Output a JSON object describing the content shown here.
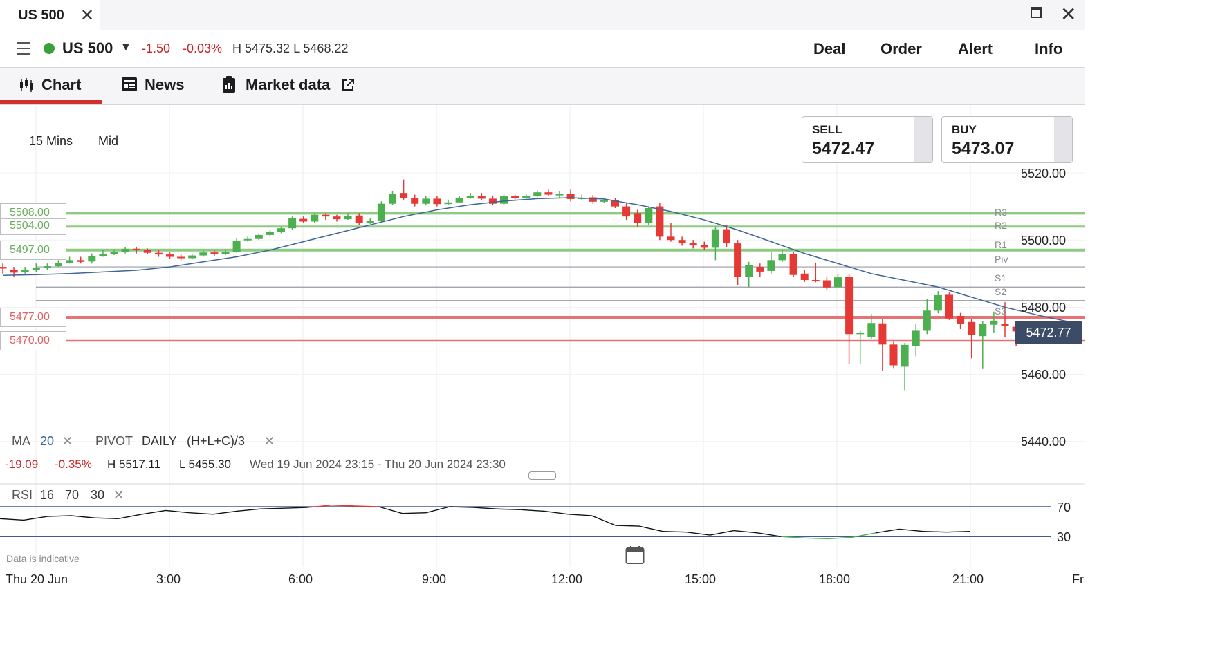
{
  "window": {
    "tab_title": "US 500"
  },
  "header": {
    "instrument": "US 500",
    "change_points": "-1.50",
    "change_percent": "-0.03%",
    "high_low": "H 5475.32  L 5468.22",
    "actions": [
      "Deal",
      "Order",
      "Alert",
      "Info"
    ]
  },
  "tabs": [
    {
      "label": "Chart",
      "icon": "candlestick-icon",
      "active": true
    },
    {
      "label": "News",
      "icon": "newspaper-icon"
    },
    {
      "label": "Market data",
      "icon": "clipboard-icon",
      "external": "external-link-icon"
    }
  ],
  "chart_controls": {
    "timeframe": "15 Mins",
    "price_type": "Mid"
  },
  "quotes": {
    "sell_label": "SELL",
    "sell_value": "5472.47",
    "buy_label": "BUY",
    "buy_value": "5473.07"
  },
  "current_price": "5472.77",
  "level_boxes": {
    "r3": "5508.00",
    "r2": "5504.00",
    "r1": "5497.00",
    "s3": "5477.00",
    "s4": "5470.00"
  },
  "pivot_labels": {
    "r3": "R3",
    "r2": "R2",
    "r1": "R1",
    "piv": "Piv",
    "s1": "S1",
    "s2": "S2",
    "s3": "S3"
  },
  "indicators": {
    "ma_label": "MA",
    "ma_period": "20",
    "pivot_label": "PIVOT",
    "pivot_period": "DAILY",
    "pivot_formula": "(H+L+C)/3",
    "rsi_label": "RSI",
    "rsi_period": "16",
    "rsi_upper": "70",
    "rsi_lower": "30"
  },
  "period_stats": {
    "change": "-19.09",
    "change_pct": "-0.35%",
    "high": "H 5517.11",
    "low": "L 5455.30",
    "range": "Wed 19 Jun 2024 23:15 - Thu 20 Jun 2024 23:30"
  },
  "disclaimer": "Data is indicative",
  "colors": {
    "up": "#4caf50",
    "down": "#e53935",
    "ma": "#3d6596",
    "resistance": "#8fca83",
    "support": "#e57373",
    "accent": "#d32f2f"
  },
  "chart_data": {
    "type": "candlestick",
    "y_ticks": [
      "5520.00",
      "5500.00",
      "5480.00",
      "5460.00",
      "5440.00"
    ],
    "ylim": [
      5435,
      5540
    ],
    "x_ticks": [
      "Thu 20 Jun",
      "3:00",
      "6:00",
      "9:00",
      "12:00",
      "15:00",
      "18:00",
      "21:00",
      "Fr"
    ],
    "levels": {
      "R3": 5508,
      "R2": 5504,
      "R1": 5497,
      "Piv": 5492,
      "S1": 5486,
      "S2": 5482,
      "S3": 5477,
      "S4": 5470
    },
    "candles": [
      [
        5492,
        5491.5,
        5493,
        5490
      ],
      [
        5491,
        5490.3,
        5492,
        5489
      ],
      [
        5490.4,
        5491.2,
        5492,
        5490
      ],
      [
        5491,
        5491.8,
        5493,
        5490.5
      ],
      [
        5491.8,
        5492.2,
        5493,
        5491
      ],
      [
        5492.2,
        5493.2,
        5494,
        5492
      ],
      [
        5493.2,
        5494,
        5495,
        5493
      ],
      [
        5494,
        5493.5,
        5495,
        5493
      ],
      [
        5493.6,
        5495.2,
        5496,
        5493
      ],
      [
        5495.2,
        5495.8,
        5497,
        5495
      ],
      [
        5495.8,
        5496.4,
        5497,
        5495.5
      ],
      [
        5496.4,
        5497.4,
        5498,
        5496
      ],
      [
        5497.4,
        5497,
        5498,
        5496
      ],
      [
        5497,
        5496.2,
        5497.5,
        5495.8
      ],
      [
        5496.2,
        5495.7,
        5497,
        5495
      ],
      [
        5495.7,
        5495,
        5496.3,
        5494.5
      ],
      [
        5495,
        5494.6,
        5495.8,
        5494
      ],
      [
        5494.6,
        5495.4,
        5496,
        5494.2
      ],
      [
        5495.4,
        5496.3,
        5497,
        5495
      ],
      [
        5496.3,
        5495.9,
        5497,
        5495.3
      ],
      [
        5495.9,
        5496.5,
        5497.3,
        5495.5
      ],
      [
        5496.5,
        5499.8,
        5500.5,
        5496.2
      ],
      [
        5500,
        5500.3,
        5501,
        5499.5
      ],
      [
        5500.3,
        5501.5,
        5502,
        5500
      ],
      [
        5501.5,
        5502.5,
        5503,
        5501
      ],
      [
        5502.5,
        5503.5,
        5504,
        5502
      ],
      [
        5503.5,
        5506.5,
        5507,
        5503
      ],
      [
        5506.3,
        5505.5,
        5507,
        5505
      ],
      [
        5505.5,
        5507.5,
        5508,
        5505.2
      ],
      [
        5507.5,
        5507,
        5508,
        5506
      ],
      [
        5507,
        5506.2,
        5507.5,
        5505.5
      ],
      [
        5506.2,
        5507.2,
        5508,
        5506
      ],
      [
        5507.3,
        5505,
        5508,
        5504.5
      ],
      [
        5505,
        5505.7,
        5506.5,
        5504.8
      ],
      [
        5505.7,
        5510.8,
        5511.5,
        5505.5
      ],
      [
        5510.8,
        5513.8,
        5514.5,
        5510.5
      ],
      [
        5514,
        5512.5,
        5518,
        5512
      ],
      [
        5512.5,
        5510.8,
        5513.5,
        5510
      ],
      [
        5510.8,
        5512.3,
        5513,
        5510.5
      ],
      [
        5512.3,
        5510.7,
        5513,
        5510
      ],
      [
        5510.7,
        5511.2,
        5512,
        5510.3
      ],
      [
        5511.2,
        5512.6,
        5513.2,
        5511
      ],
      [
        5512.6,
        5513.2,
        5514,
        5512.3
      ],
      [
        5513,
        5512.3,
        5514,
        5512
      ],
      [
        5512.3,
        5510.8,
        5513,
        5510.3
      ],
      [
        5510.8,
        5513,
        5513.5,
        5510.5
      ],
      [
        5513,
        5512.5,
        5513.5,
        5512
      ],
      [
        5512.6,
        5513.2,
        5513.8,
        5512.3
      ],
      [
        5513.2,
        5514.2,
        5514.8,
        5512.8
      ],
      [
        5514.2,
        5513.5,
        5515,
        5513
      ],
      [
        5513.5,
        5513.7,
        5514.6,
        5512.5
      ],
      [
        5513.7,
        5512.2,
        5515,
        5511.5
      ],
      [
        5512.3,
        5512.6,
        5513.5,
        5511.8
      ],
      [
        5512.7,
        5511.4,
        5513.4,
        5510.8
      ],
      [
        5511.4,
        5511.8,
        5512.4,
        5511
      ],
      [
        5511.8,
        5510,
        5512.5,
        5509.5
      ],
      [
        5510,
        5507,
        5511,
        5506
      ],
      [
        5508,
        5505,
        5509,
        5504
      ],
      [
        5505,
        5509.5,
        5510,
        5504.5
      ],
      [
        5510,
        5501,
        5511,
        5500
      ],
      [
        5501,
        5500,
        5505,
        5499.5
      ],
      [
        5500,
        5499.2,
        5501,
        5498.3
      ],
      [
        5499.2,
        5498.5,
        5500,
        5497.5
      ],
      [
        5498.5,
        5497.7,
        5499.5,
        5497
      ],
      [
        5497.7,
        5503.2,
        5504,
        5494
      ],
      [
        5503.2,
        5499,
        5504.5,
        5497.8
      ],
      [
        5499,
        5489,
        5500,
        5486.5
      ],
      [
        5489,
        5492.6,
        5493.5,
        5486
      ],
      [
        5492,
        5490.6,
        5493,
        5489
      ],
      [
        5490.8,
        5494,
        5496.5,
        5490
      ],
      [
        5494,
        5495.8,
        5497,
        5493.5
      ],
      [
        5495.8,
        5489.6,
        5496.5,
        5489
      ],
      [
        5490,
        5488.1,
        5491,
        5487.5
      ],
      [
        5488.1,
        5487.9,
        5493.3,
        5487.4
      ],
      [
        5488,
        5485.9,
        5489,
        5485
      ],
      [
        5486,
        5488.9,
        5489.9,
        5485.6
      ],
      [
        5489,
        5472,
        5490,
        5463
      ],
      [
        5472,
        5472.4,
        5473,
        5463
      ],
      [
        5471.2,
        5475.3,
        5478,
        5470.4
      ],
      [
        5475.2,
        5468.9,
        5476.5,
        5461
      ],
      [
        5468.9,
        5462.7,
        5469.7,
        5461.7
      ],
      [
        5462.3,
        5468.8,
        5469.4,
        5455.3
      ],
      [
        5468.5,
        5473,
        5475,
        5465.4
      ],
      [
        5473,
        5479,
        5482.4,
        5472
      ],
      [
        5479,
        5483.6,
        5484.8,
        5478.2
      ],
      [
        5483.7,
        5476.7,
        5484.6,
        5476.2
      ],
      [
        5477.4,
        5475,
        5478.3,
        5473.5
      ],
      [
        5475.6,
        5471.8,
        5476.5,
        5464.8
      ],
      [
        5471.4,
        5475,
        5475.8,
        5461.6
      ],
      [
        5474.8,
        5476,
        5478.7,
        5472.4
      ],
      [
        5475,
        5474.5,
        5481.5,
        5471
      ],
      [
        5474.2,
        5472.8,
        5475.4,
        5468.5
      ]
    ],
    "ma20": [
      5489.5,
      5489.7,
      5490,
      5490.5,
      5491,
      5492,
      5493.5,
      5495,
      5497,
      5499.5,
      5502,
      5504.5,
      5507,
      5509,
      5510.5,
      5511.6,
      5512.3,
      5512.6,
      5512.2,
      5510.5,
      5508.5,
      5506,
      5503,
      5499.5,
      5496,
      5493,
      5490,
      5488,
      5486,
      5483,
      5480,
      5477.6,
      5475.5
    ],
    "rsi": [
      54,
      52,
      57,
      58,
      55,
      54,
      60,
      65,
      62,
      60,
      64,
      67,
      68,
      69,
      72,
      71,
      70,
      61,
      62,
      70,
      69,
      67,
      66,
      64,
      60,
      58,
      45,
      44,
      37,
      36,
      32,
      38,
      35,
      30,
      28,
      27,
      29,
      35,
      40,
      37,
      36,
      37
    ]
  }
}
